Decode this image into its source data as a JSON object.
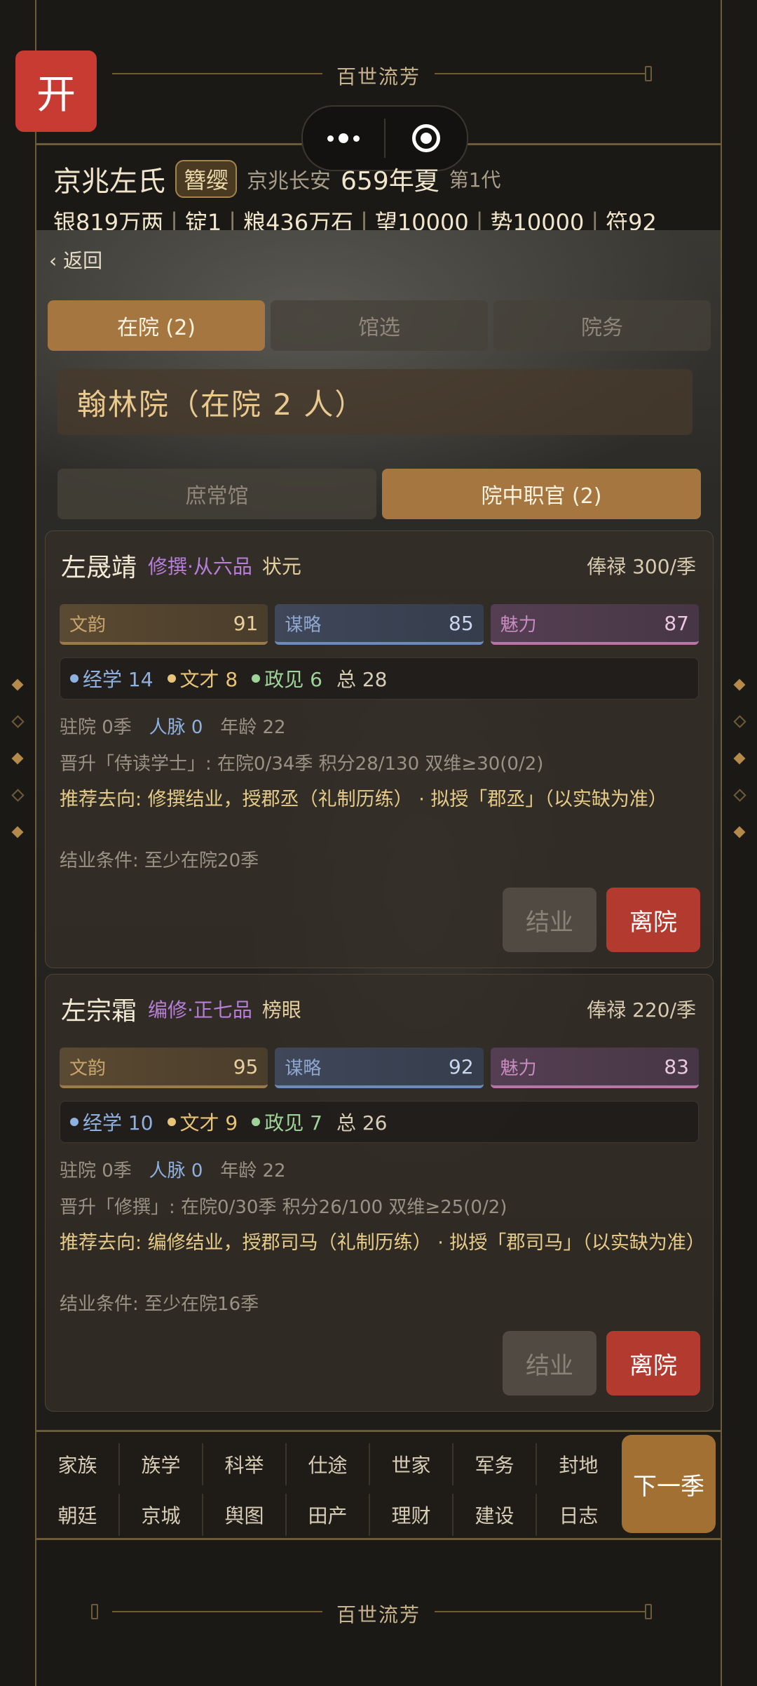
{
  "banner_title": "百世流芳",
  "open_label": "开",
  "header": {
    "clan_name": "京兆左氏",
    "badge": "簪缨",
    "location": "京兆长安",
    "year": "659年夏",
    "generation": "第1代",
    "resources": [
      "银819万两",
      "锭1",
      "粮436万石",
      "望10000",
      "势10000",
      "符92"
    ]
  },
  "back_label": "返回",
  "tabs": [
    {
      "label": "在院 (2)",
      "active": true
    },
    {
      "label": "馆选",
      "active": false
    },
    {
      "label": "院务",
      "active": false
    }
  ],
  "section_title": "翰林院（在院 2 人）",
  "subtabs": [
    {
      "label": "庶常馆",
      "active": false
    },
    {
      "label": "院中职官 (2)",
      "active": true
    }
  ],
  "cards": [
    {
      "name": "左晟靖",
      "rank": "修撰·从六品",
      "title": "状元",
      "salary": "俸禄 300/季",
      "stats": {
        "wenyun_label": "文韵",
        "wenyun": 91,
        "moulue_label": "谋略",
        "moulue": 85,
        "meili_label": "魅力",
        "meili": 87
      },
      "skills": {
        "jingxue": "经学 14",
        "wencai": "文才 8",
        "zhengjian": "政见 6",
        "total": "总 28"
      },
      "stay_label": "驻院 0季",
      "renmai": "人脉 0",
      "age": "年龄 22",
      "promotion": "晋升「侍读学士」: 在院0/34季 积分28/130 双维≥30(0/2)",
      "recommend": "推荐去向: 修撰结业，授郡丞（礼制历练） · 拟授「郡丞」（以实缺为准）",
      "graduate_cond": "结业条件: 至少在院20季",
      "btn_graduate": "结业",
      "btn_leave": "离院"
    },
    {
      "name": "左宗霜",
      "rank": "编修·正七品",
      "title": "榜眼",
      "salary": "俸禄 220/季",
      "stats": {
        "wenyun_label": "文韵",
        "wenyun": 95,
        "moulue_label": "谋略",
        "moulue": 92,
        "meili_label": "魅力",
        "meili": 83
      },
      "skills": {
        "jingxue": "经学 10",
        "wencai": "文才 9",
        "zhengjian": "政见 7",
        "total": "总 26"
      },
      "stay_label": "驻院 0季",
      "renmai": "人脉 0",
      "age": "年龄 22",
      "promotion": "晋升「修撰」: 在院0/30季 积分26/100 双维≥25(0/2)",
      "recommend": "推荐去向: 编修结业，授郡司马（礼制历练） · 拟授「郡司马」（以实缺为准）",
      "graduate_cond": "结业条件: 至少在院16季",
      "btn_graduate": "结业",
      "btn_leave": "离院"
    }
  ],
  "nav_row1": [
    "家族",
    "族学",
    "科举",
    "仕途",
    "世家",
    "军务",
    "封地"
  ],
  "nav_row2": [
    "朝廷",
    "京城",
    "舆图",
    "田产",
    "理财",
    "建设",
    "日志"
  ],
  "next_season": "下一季"
}
